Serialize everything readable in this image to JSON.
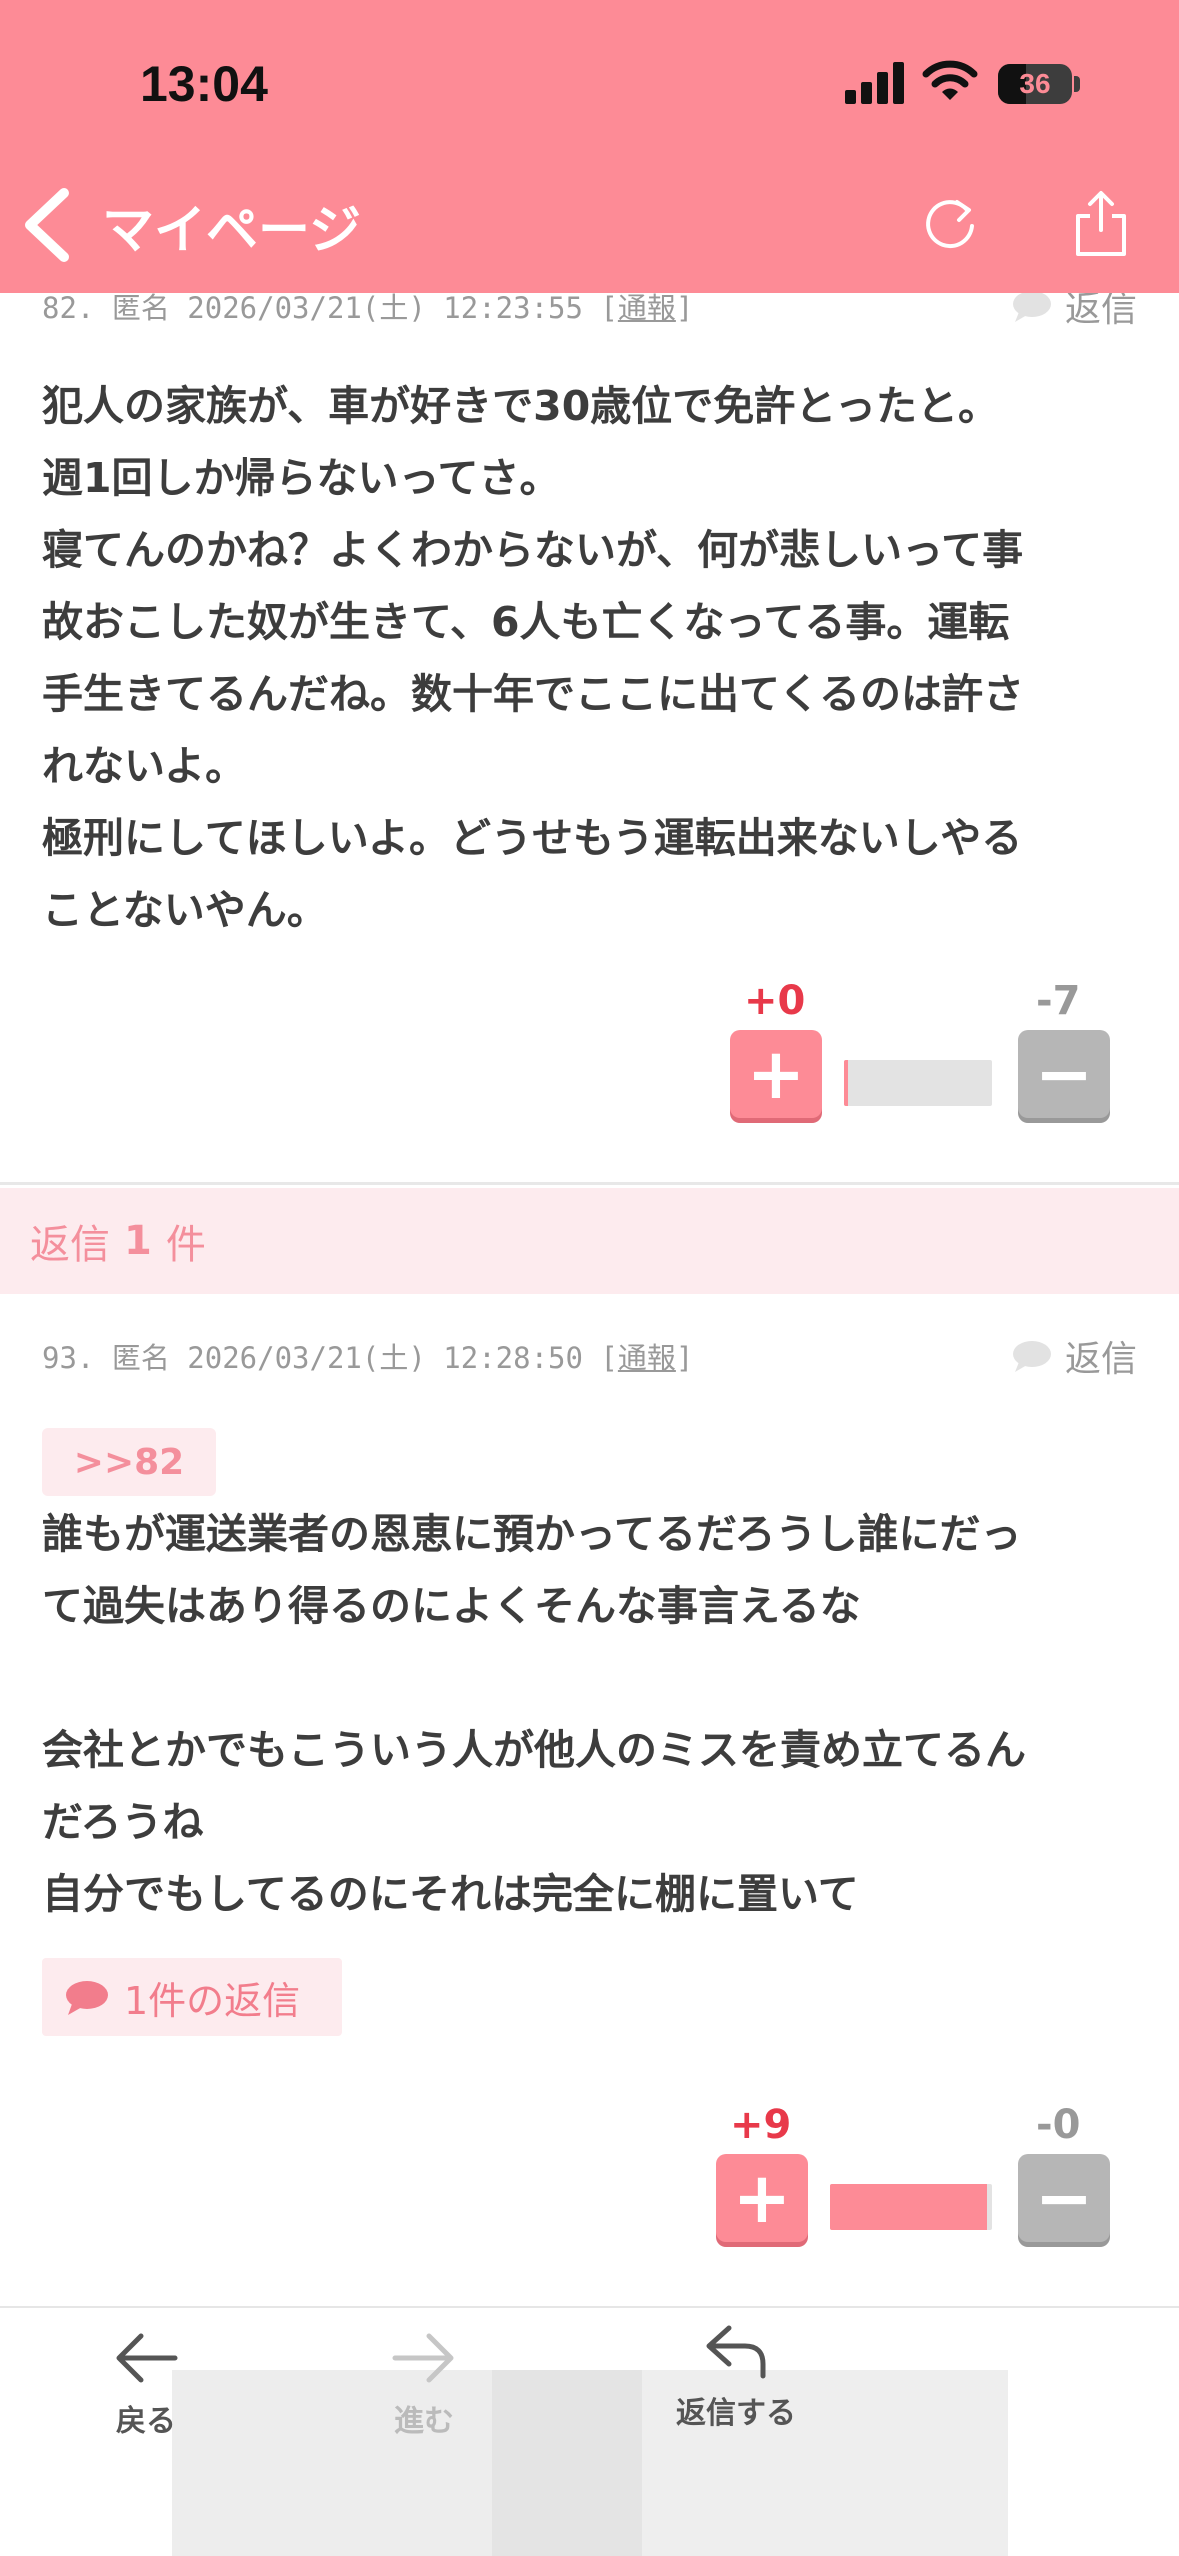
{
  "status_bar": {
    "time": "13:04",
    "battery": "36"
  },
  "header": {
    "back_label": "マイページ",
    "accent_color": "#fd8b96"
  },
  "comments": [
    {
      "meta": "82. 匿名 2026/03/21(土) 12:23:55",
      "report": "通報",
      "reply_label": "返信",
      "body": "犯人の家族が、車が好きで30歳位で免許とったと。\n週1回しか帰らないってさ。\n寝てんのかね？よくわからないが、何が悲しいって事\n故おこした奴が生きて、6人も亡くなってる事。運転\n手生きてるんだね。数十年でここに出てくるのは許さ\nれないよ。\n極刑にしてほしいよ。どうせもう運転出来ないしやる\nことないやん。",
      "votes": {
        "plus": "+0",
        "minus": "-7",
        "plus_ratio": 0.03
      }
    },
    {
      "meta": "93. 匿名 2026/03/21(土) 12:28:50",
      "report": "通報",
      "reply_label": "返信",
      "anchor": ">>82",
      "body": "誰もが運送業者の恩恵に預かってるだろうし誰にだっ\nて過失はあり得るのによくそんな事言えるな\n\n会社とかでもこういう人が他人のミスを責め立てるん\nだろうね\n自分でもしてるのにそれは完全に棚に置いて",
      "replies_chip": "1件の返信",
      "votes": {
        "plus": "+9",
        "minus": "-0",
        "plus_ratio": 0.97
      }
    }
  ],
  "reply_count": {
    "prefix": "返信",
    "count": "1",
    "suffix": "件"
  },
  "bottom_nav": {
    "back": "戻る",
    "forward": "進む",
    "reply": "返信する"
  }
}
